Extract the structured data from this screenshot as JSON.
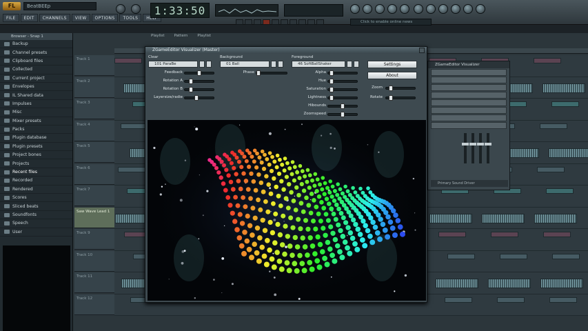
{
  "app": {
    "logo_text": "FL",
    "project_title": "BeatBEEp",
    "menu": [
      "FILE",
      "EDIT",
      "CHANNELS",
      "VIEW",
      "OPTIONS",
      "TOOLS",
      "HELP"
    ],
    "time": "1:33:50",
    "hint": "Click to enable online news"
  },
  "browser": {
    "header": "Browser - Snap 1",
    "items": [
      "Backup",
      "Channel presets",
      "Clipboard files",
      "Collected",
      "Current project",
      "Envelopes",
      "IL Shared data",
      "Impulses",
      "Misc",
      "Mixer presets",
      "Packs",
      "Plugin database",
      "Plugin presets",
      "Project bones",
      "Projects",
      "Recent files",
      "Recorded",
      "Rendered",
      "Scores",
      "Sliced beats",
      "Soundfonts",
      "Speech",
      "User"
    ]
  },
  "playlist": {
    "toolbar": [
      "Playlist",
      "Pattern",
      "Playlist"
    ],
    "tracks": [
      "Track 1",
      "Track 2",
      "Track 3",
      "Track 4",
      "Track 5",
      "Track 6",
      "Track 7",
      "Saw Wave Lead 1",
      "Track 9",
      "Track 10",
      "Track 11",
      "Track 12"
    ]
  },
  "mixer": {
    "title": "ZGameEditor Visualizer",
    "footer": "Primary Sound Driver"
  },
  "visualizer": {
    "title": "ZGameEditor Visualizer (Master)",
    "clear_label": "Clear",
    "clear_value": "101 ParaBe",
    "background_label": "Background",
    "background_value": "01 Ball",
    "foreground_label": "Foreground",
    "foreground_value": "46 SoftBallShaker",
    "feedback_label": "Feedback",
    "rotation_a_label": "Rotation A",
    "rotation_b_label": "Rotation B",
    "layersize_label": "Layersize/radie",
    "phase_label": "Phase",
    "alpha_label": "Alpha",
    "hue_label": "Hue",
    "saturation_label": "Saturation",
    "lightness_label": "Lightness",
    "hibounds_label": "Hibounds",
    "zoomspeed_label": "Zoomspeed",
    "zoom_label": "Zoom",
    "rotate_label": "Rotate",
    "settings_label": "Settings",
    "about_label": "About"
  }
}
